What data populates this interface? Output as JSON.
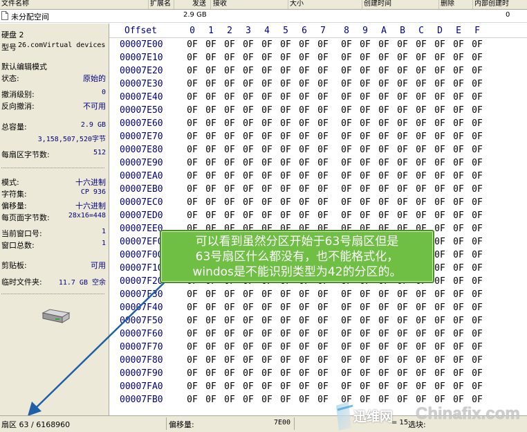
{
  "file_list": {
    "columns": [
      "文件名称",
      "扩展名",
      "发送",
      "接收",
      "大小",
      "创建时间",
      "删除",
      "内部创建时"
    ],
    "row": {
      "name": "未分配空间",
      "size": "2.9 GB",
      "last_value": "0"
    }
  },
  "info_panel": {
    "disk": "硬盘 2",
    "model_label": "型号",
    "model_value": "26.comVirtual devices",
    "mode_title": "默认编辑模式",
    "state_label": "状态:",
    "state_value": "原始的",
    "undo_level_label": "撤消级别:",
    "undo_level_value": "0",
    "reverse_undo_label": "反向撤消:",
    "reverse_undo_value": "不可用",
    "total_label": "总容量:",
    "total_value": "2.9 GB",
    "total_bytes": "3,158,507,520字节",
    "bytes_per_sector_label": "每扇区字节数:",
    "bytes_per_sector_value": "512",
    "mode_label": "模式:",
    "mode_value": "十六进制",
    "charset_label": "字符集:",
    "charset_value": "CP 936",
    "offset_label": "偏移量:",
    "offset_value": "十六进制",
    "bytes_per_page_label": "每页面字节数:",
    "bytes_per_page_value": "28x16=448",
    "current_window_label": "当前窗口号:",
    "current_window_value": "1",
    "window_count_label": "窗口总数:",
    "window_count_value": "1",
    "clipboard_label": "剪贴板:",
    "clipboard_value": "可用",
    "temp_folder_label": "临时文件夹:",
    "temp_folder_value": "11.7 GB 空余"
  },
  "hex_view": {
    "offset_header": "Offset",
    "column_headers": [
      "0",
      "1",
      "2",
      "3",
      "4",
      "5",
      "6",
      "7",
      "8",
      "9",
      "A",
      "B",
      "C",
      "D",
      "E",
      "F"
    ],
    "offsets": [
      "00007E00",
      "00007E10",
      "00007E20",
      "00007E30",
      "00007E40",
      "00007E50",
      "00007E60",
      "00007E70",
      "00007E80",
      "00007E90",
      "00007EA0",
      "00007EB0",
      "00007EC0",
      "00007ED0",
      "00007EE0",
      "00007EF0",
      "00007F00",
      "00007F10",
      "00007F20",
      "00007F30",
      "00007F40",
      "00007F50",
      "00007F60",
      "00007F70",
      "00007F80",
      "00007F90",
      "00007FA0",
      "00007FB0"
    ],
    "byte_value": "0F"
  },
  "callout": {
    "line1": "可以看到虽然分区开始于63号扇区但是",
    "line2": "63号扇区什么都没有，也不能格式化，",
    "line3": "windos是不能识别类型为42的分区的。"
  },
  "status_bar": {
    "sector": "扇区 63 / 6168960",
    "offset_label": "偏移量:",
    "offset_value": "7E00",
    "value_partial": "= 15",
    "selection_label": "选块:"
  },
  "watermark": {
    "text_cn": "迅维网",
    "text_en": "Chinafix.com"
  },
  "colors": {
    "callout_bg": "#6fbf45",
    "offset_text": "#000080",
    "arrow": "#1f5fa8"
  }
}
